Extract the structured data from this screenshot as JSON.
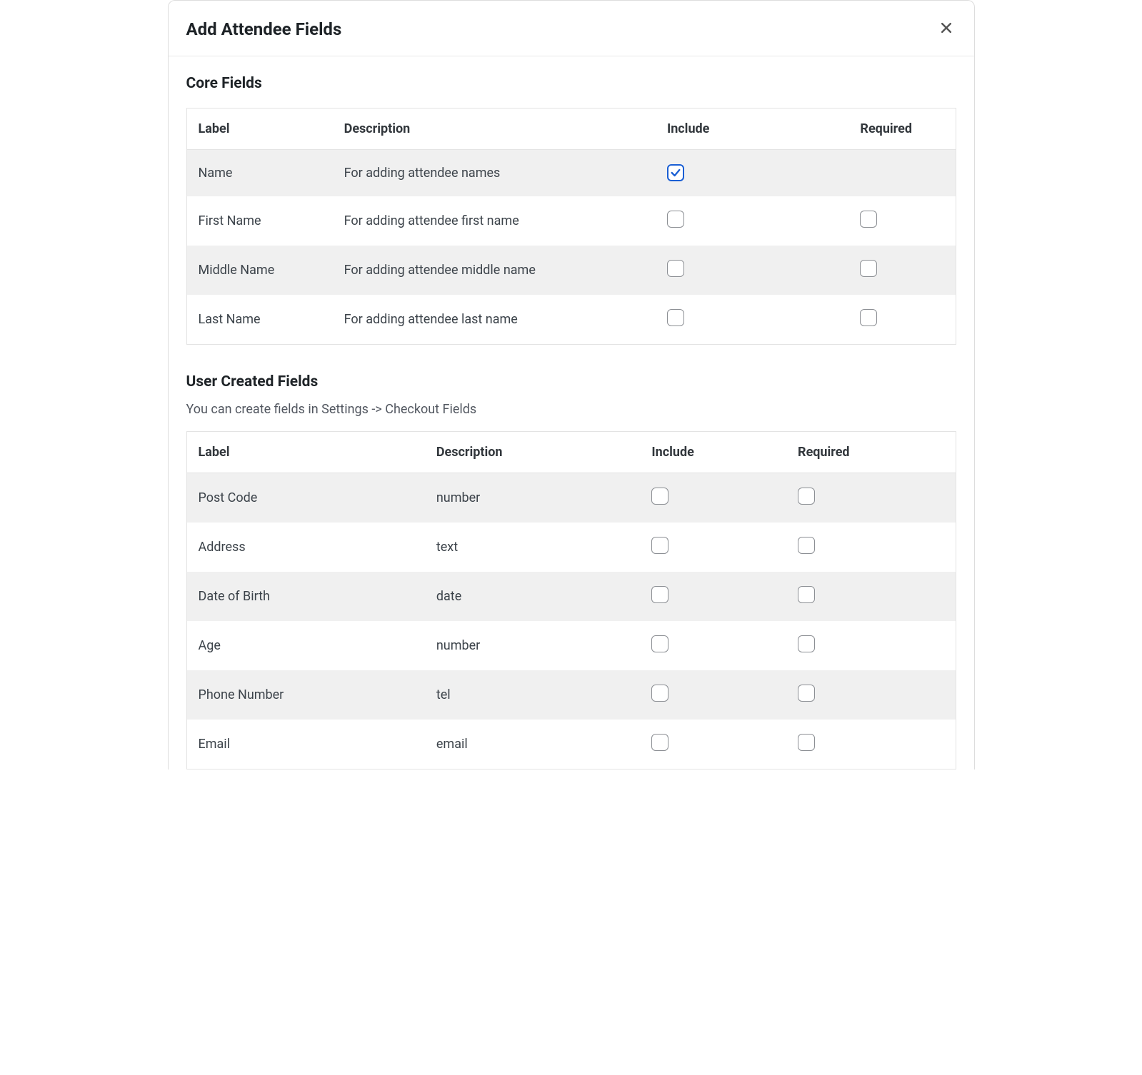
{
  "modal": {
    "title": "Add Attendee Fields"
  },
  "core": {
    "title": "Core Fields",
    "headers": {
      "label": "Label",
      "description": "Description",
      "include": "Include",
      "required": "Required"
    },
    "rows": [
      {
        "label": "Name",
        "description": "For adding attendee names",
        "include": true,
        "required_hidden": true
      },
      {
        "label": "First Name",
        "description": "For adding attendee first name",
        "include": false,
        "required": false
      },
      {
        "label": "Middle Name",
        "description": "For adding attendee middle name",
        "include": false,
        "required": false
      },
      {
        "label": "Last Name",
        "description": "For adding attendee last name",
        "include": false,
        "required": false
      }
    ]
  },
  "user": {
    "title": "User Created Fields",
    "help": "You can create fields in Settings -> Checkout Fields",
    "headers": {
      "label": "Label",
      "description": "Description",
      "include": "Include",
      "required": "Required"
    },
    "rows": [
      {
        "label": "Post Code",
        "description": "number",
        "include": false,
        "required": false
      },
      {
        "label": "Address",
        "description": "text",
        "include": false,
        "required": false
      },
      {
        "label": "Date of Birth",
        "description": "date",
        "include": false,
        "required": false
      },
      {
        "label": "Age",
        "description": "number",
        "include": false,
        "required": false
      },
      {
        "label": "Phone Number",
        "description": "tel",
        "include": false,
        "required": false
      },
      {
        "label": "Email",
        "description": "email",
        "include": false,
        "required": false
      }
    ]
  }
}
